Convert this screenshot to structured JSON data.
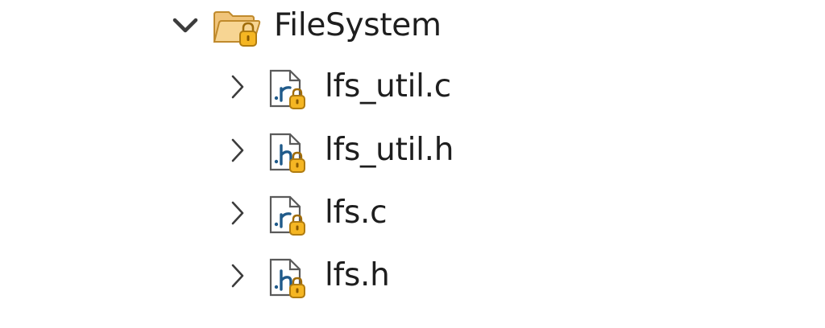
{
  "tree": {
    "folder": {
      "label": "FileSystem",
      "expanded": true,
      "icon": "folder-icon"
    },
    "files": [
      {
        "label": "lfs_util.c",
        "type": "c",
        "icon": "c-source-file-icon"
      },
      {
        "label": "lfs_util.h",
        "type": "h",
        "icon": "header-file-icon"
      },
      {
        "label": "lfs.c",
        "type": "c",
        "icon": "c-source-file-icon"
      },
      {
        "label": "lfs.h",
        "type": "h",
        "icon": "header-file-icon"
      }
    ]
  },
  "colors": {
    "text": "#1e1e1e",
    "chevron": "#3c3c3c",
    "folder": "#e8b04a",
    "lock": "#f2b01e",
    "file_letter": "#1f5a8a"
  }
}
